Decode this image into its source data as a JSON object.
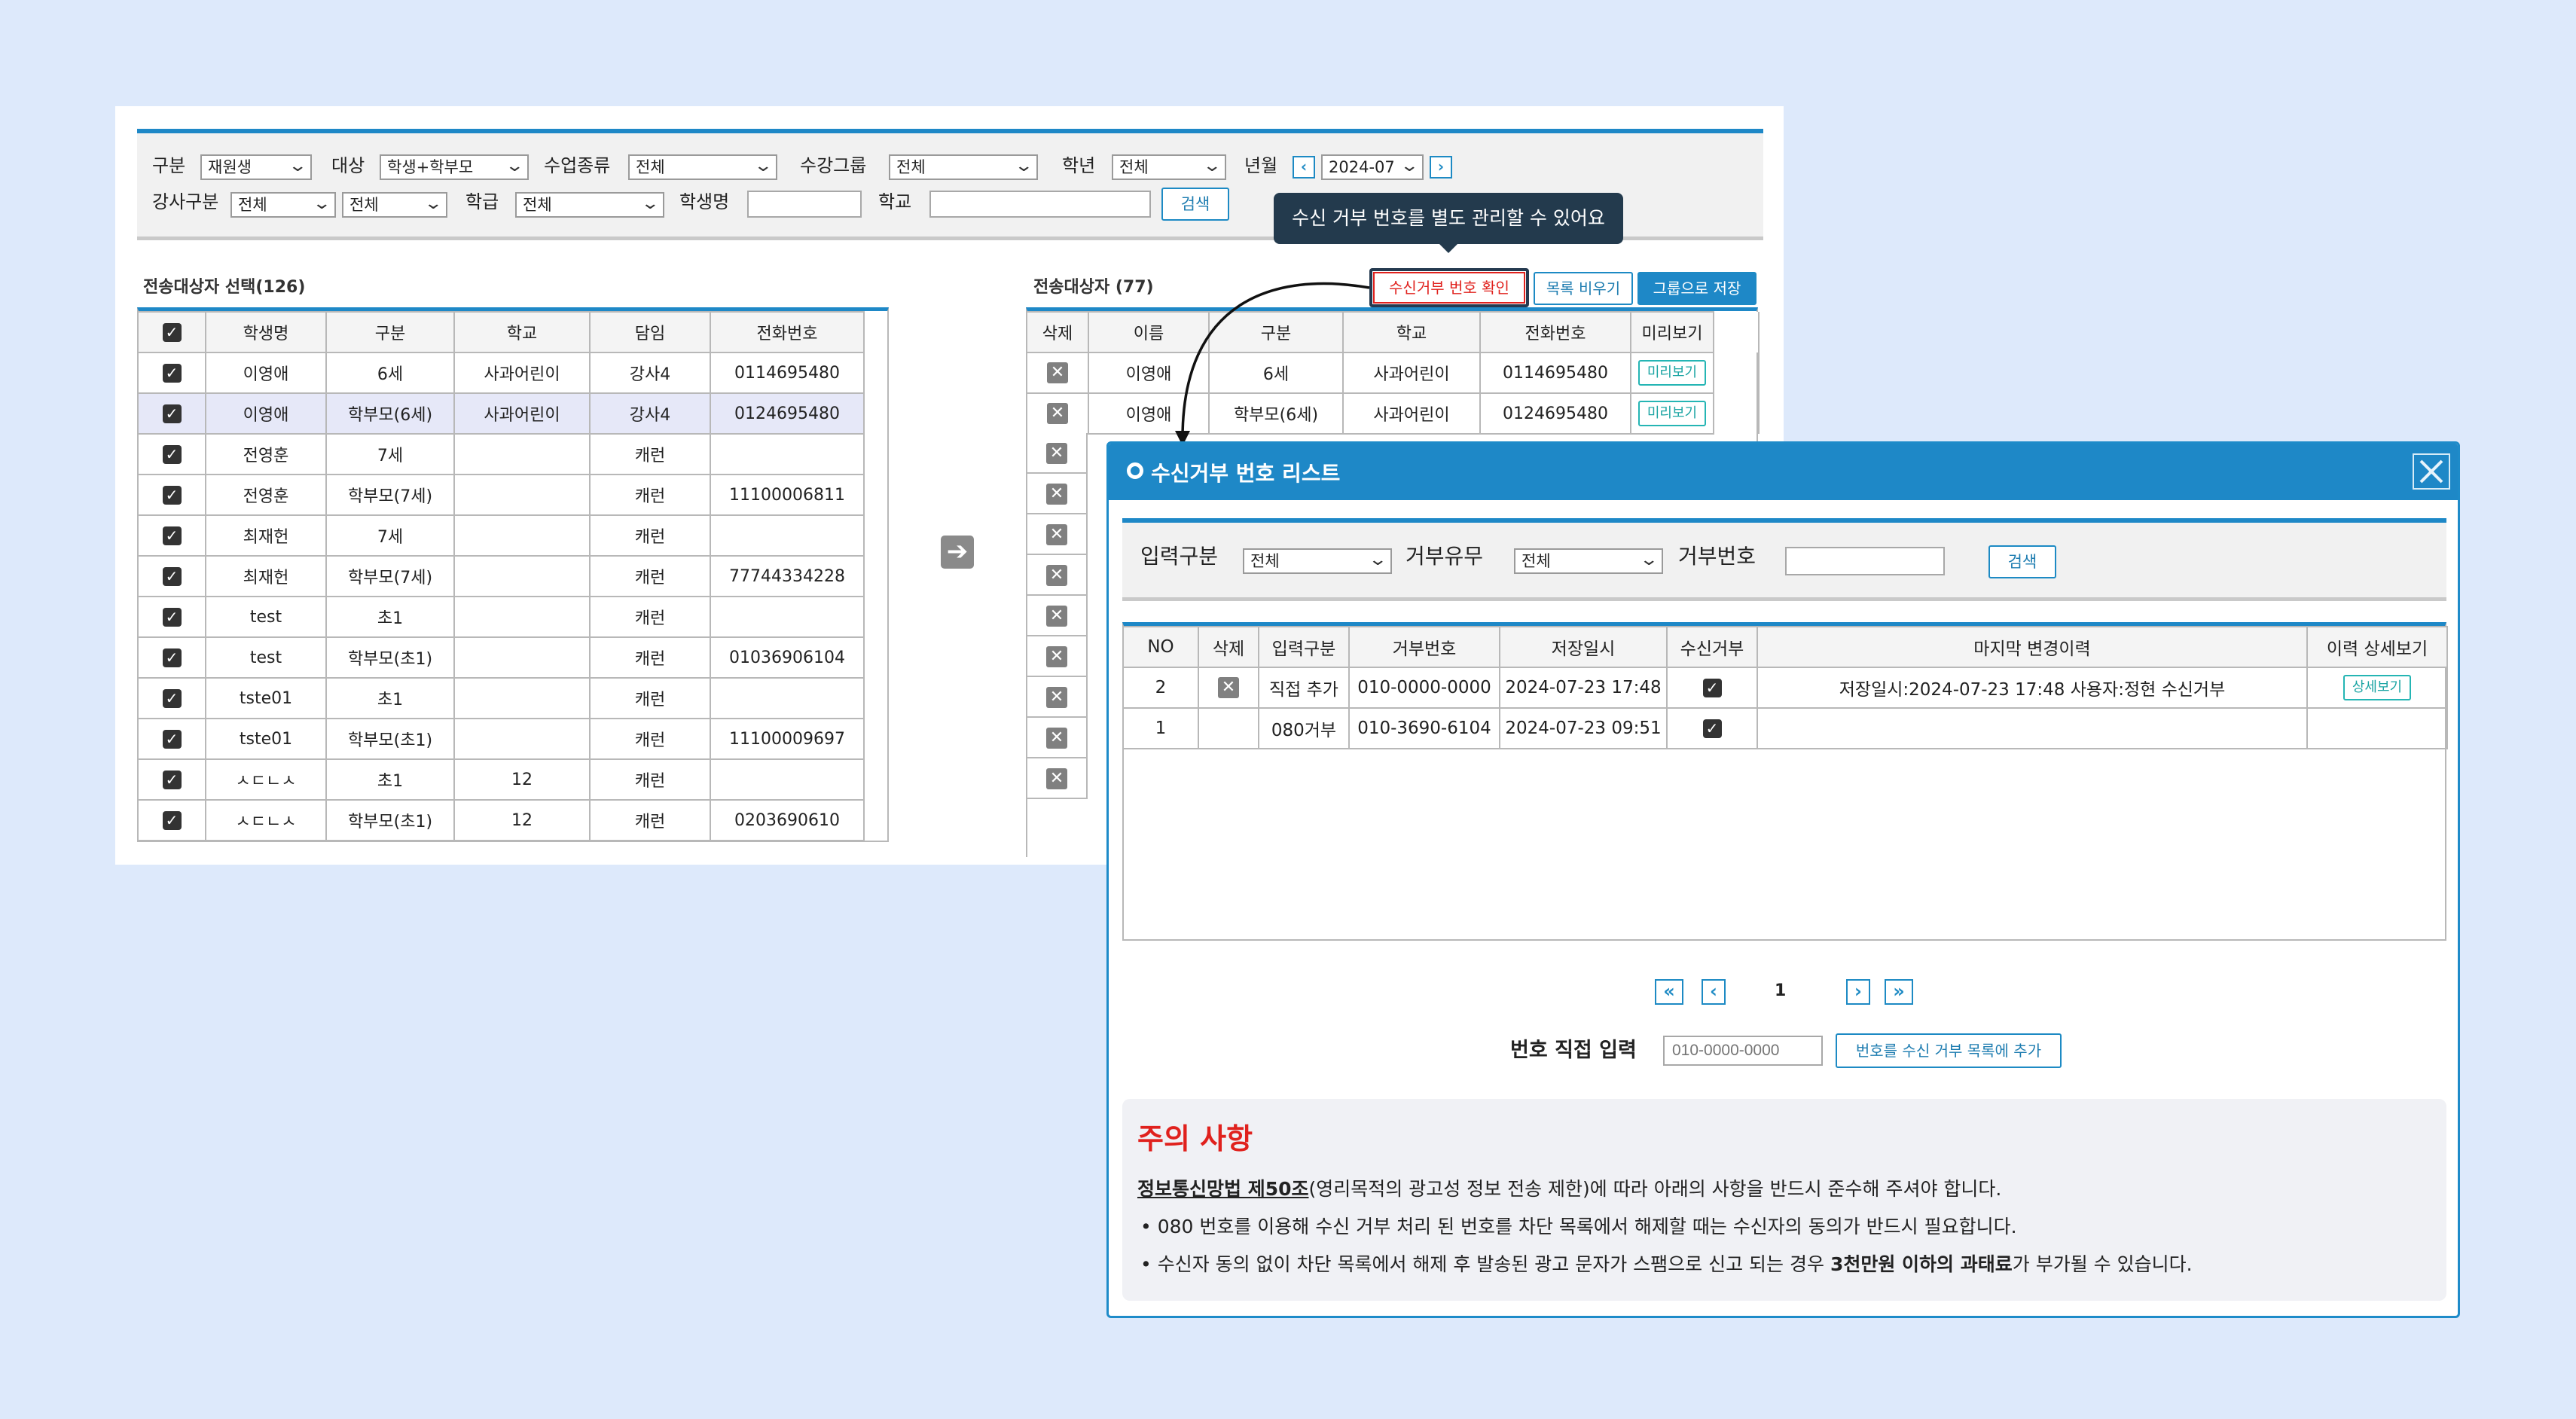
{
  "filters": {
    "row1": [
      {
        "label": "구분",
        "value": "재원생"
      },
      {
        "label": "대상",
        "value": "학생+학부모"
      },
      {
        "label": "수업종류",
        "value": "전체"
      },
      {
        "label": "수강그룹",
        "value": "전체"
      },
      {
        "label": "학년",
        "value": "전체"
      },
      {
        "label": "년월",
        "value": "2024-07"
      }
    ],
    "row2": {
      "teacher_label": "강사구분",
      "teacher_value1": "전체",
      "teacher_value2": "전체",
      "class_label": "학급",
      "class_value": "전체",
      "student_label": "학생명",
      "student_value": "",
      "school_label": "학교",
      "school_value": "",
      "search_button": "검색"
    }
  },
  "tooltip": "수신 거부 번호를 별도 관리할 수 있어요",
  "left_panel": {
    "title": "전송대상자 선택(126)",
    "columns": [
      "학생명",
      "구분",
      "학교",
      "담임",
      "전화번호"
    ],
    "rows": [
      [
        "이영애",
        "6세",
        "사과어린이",
        "강사4",
        "0114695480"
      ],
      [
        "이영애",
        "학부모(6세)",
        "사과어린이",
        "강사4",
        "0124695480"
      ],
      [
        "전영훈",
        "7세",
        "",
        "캐런",
        ""
      ],
      [
        "전영훈",
        "학부모(7세)",
        "",
        "캐런",
        "11100006811"
      ],
      [
        "최재헌",
        "7세",
        "",
        "캐런",
        ""
      ],
      [
        "최재헌",
        "학부모(7세)",
        "",
        "캐런",
        "77744334228"
      ],
      [
        "test",
        "초1",
        "",
        "캐런",
        ""
      ],
      [
        "test",
        "학부모(초1)",
        "",
        "캐런",
        "01036906104"
      ],
      [
        "tste01",
        "초1",
        "",
        "캐런",
        ""
      ],
      [
        "tste01",
        "학부모(초1)",
        "",
        "캐런",
        "11100009697"
      ],
      [
        "ㅅㄷㄴㅅ",
        "초1",
        "12",
        "캐런",
        ""
      ],
      [
        "ㅅㄷㄴㅅ",
        "학부모(초1)",
        "12",
        "캐런",
        "0203690610"
      ]
    ]
  },
  "right_panel": {
    "title": "전송대상자 (77)",
    "buttons": {
      "reject_check": "수신거부 번호 확인",
      "clear_list": "목록 비우기",
      "save_group": "그룹으로 저장"
    },
    "columns": [
      "삭제",
      "이름",
      "구분",
      "학교",
      "전화번호",
      "미리보기"
    ],
    "rows": [
      [
        "이영애",
        "6세",
        "사과어린이",
        "0114695480",
        "미리보기"
      ],
      [
        "이영애",
        "학부모(6세)",
        "사과어린이",
        "0124695480",
        "미리보기"
      ]
    ]
  },
  "modal": {
    "title": "수신거부 번호 리스트",
    "filters": {
      "input_type_label": "입력구분",
      "input_type_value": "전체",
      "reject_label": "거부유무",
      "reject_value": "전체",
      "number_label": "거부번호",
      "number_value": "",
      "search_button": "검색"
    },
    "columns": [
      "NO",
      "삭제",
      "입력구분",
      "거부번호",
      "저장일시",
      "수신거부",
      "마지막 변경이력",
      "이력 상세보기"
    ],
    "rows": [
      {
        "no": "2",
        "input_type": "직접 추가",
        "number": "010-0000-0000",
        "saved_at": "2024-07-23 17:48",
        "history": "저장일시:2024-07-23 17:48 사용자:정현 수신거부",
        "detail": "상세보기"
      },
      {
        "no": "1",
        "input_type": "080거부",
        "number": "010-3690-6104",
        "saved_at": "2024-07-23 09:51",
        "history": "",
        "detail": ""
      }
    ],
    "page": "1",
    "direct_input_label": "번호 직접 입력",
    "direct_input_placeholder": "010-0000-0000",
    "add_button": "번호를 수신 거부 목록에 추가",
    "notice": {
      "title": "주의 사항",
      "law": "정보통신망법 제50조",
      "law_rest": "(영리목적의 광고성 정보 전송 제한)에 따라 아래의 사항을 반드시 준수해 주셔야 합니다.",
      "bullet1": "• 080 번호를 이용해 수신 거부 처리 된 번호를 차단 목록에서 해제할 때는 수신자의 동의가 반드시 필요합니다.",
      "bullet2_pre": "• 수신자 동의 없이 차단 목록에서 해제 후 발송된 광고 문자가 스팸으로 신고 되는 경우 ",
      "bullet2_bold": "3천만원 이하의 과태료",
      "bullet2_post": "가 부가될 수 있습니다."
    }
  },
  "colors": {
    "accent": "#1e88c7",
    "warning": "#e0211d",
    "background": "#dde9fb"
  }
}
